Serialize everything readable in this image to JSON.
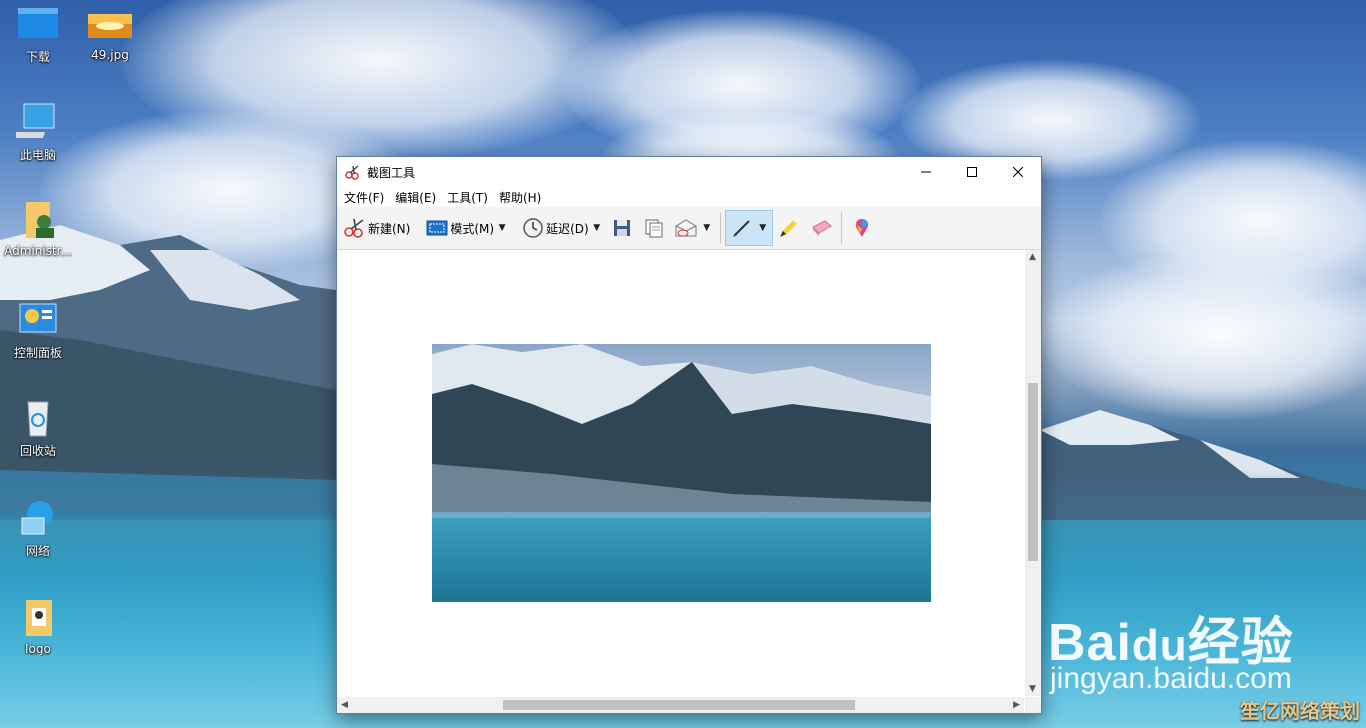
{
  "desktop": {
    "icons": [
      {
        "label": "下载",
        "icon": "folder-download-icon"
      },
      {
        "label": "49.jpg",
        "icon": "image-file-icon"
      },
      {
        "label": "此电脑",
        "icon": "computer-icon"
      },
      {
        "label": "Administr...",
        "icon": "user-folder-icon"
      },
      {
        "label": "控制面板",
        "icon": "control-panel-icon"
      },
      {
        "label": "回收站",
        "icon": "recycle-bin-icon"
      },
      {
        "label": "网络",
        "icon": "network-icon"
      },
      {
        "label": "logo",
        "icon": "folder-icon"
      }
    ]
  },
  "window": {
    "title": "截图工具",
    "menu": [
      "文件(F)",
      "编辑(E)",
      "工具(T)",
      "帮助(H)"
    ],
    "toolbar": {
      "new_label": "新建(N)",
      "mode_label": "模式(M)",
      "delay_label": "延迟(D)"
    }
  },
  "watermark": {
    "brand": "Bai",
    "brand_suffix": "经验",
    "url": "jingyan.baidu.com",
    "corner": "笙亿网络策划"
  },
  "colors": {
    "accent": "#cce4f7",
    "window_border": "#5a7fa8"
  }
}
